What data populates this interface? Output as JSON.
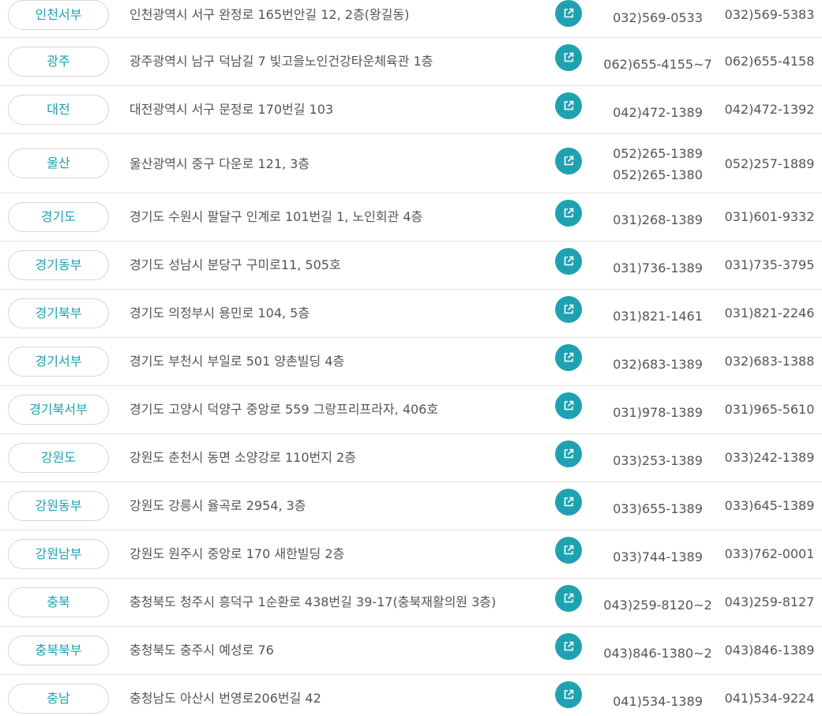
{
  "accent_color": "#1ea2b2",
  "link_icon": "external-link-icon",
  "rows": [
    {
      "region": "인천서부",
      "address": "인천광역시 서구 완정로 165번안길 12, 2층(왕길동)",
      "tel": [
        "032)569-0533"
      ],
      "fax": "032)569-5383"
    },
    {
      "region": "광주",
      "address": "광주광역시 남구 덕남길 7 빛고을노인건강타운체육관 1층",
      "tel": [
        "062)655-4155~7"
      ],
      "fax": "062)655-4158"
    },
    {
      "region": "대전",
      "address": "대전광역시 서구 문정로 170번길 103",
      "tel": [
        "042)472-1389"
      ],
      "fax": "042)472-1392"
    },
    {
      "region": "울산",
      "address": "울산광역시 중구 다운로 121, 3층",
      "tel": [
        "052)265-1389",
        "052)265-1380"
      ],
      "fax": "052)257-1889"
    },
    {
      "region": "경기도",
      "address": "경기도 수원시 팔달구 인계로 101번길 1, 노인회관 4층",
      "tel": [
        "031)268-1389"
      ],
      "fax": "031)601-9332"
    },
    {
      "region": "경기동부",
      "address": "경기도 성남시 분당구 구미로11, 505호",
      "tel": [
        "031)736-1389"
      ],
      "fax": "031)735-3795"
    },
    {
      "region": "경기북부",
      "address": "경기도 의정부시 용민로 104, 5층",
      "tel": [
        "031)821-1461"
      ],
      "fax": "031)821-2246"
    },
    {
      "region": "경기서부",
      "address": "경기도 부천시 부일로 501 양촌빌딩 4층",
      "tel": [
        "032)683-1389"
      ],
      "fax": "032)683-1388"
    },
    {
      "region": "경기북서부",
      "address": "경기도 고양시 덕양구 중앙로 559 그랑프리프라자, 406호",
      "tel": [
        "031)978-1389"
      ],
      "fax": "031)965-5610"
    },
    {
      "region": "강원도",
      "address": "강원도 춘천시 동면 소양강로 110번지 2층",
      "tel": [
        "033)253-1389"
      ],
      "fax": "033)242-1389"
    },
    {
      "region": "강원동부",
      "address": "강원도 강릉시 율곡로 2954, 3층",
      "tel": [
        "033)655-1389"
      ],
      "fax": "033)645-1389"
    },
    {
      "region": "강원남부",
      "address": "강원도 원주시 중앙로 170 새한빌딩 2층",
      "tel": [
        "033)744-1389"
      ],
      "fax": "033)762-0001"
    },
    {
      "region": "충북",
      "address": "충청북도 청주시 흥덕구 1순환로 438번길 39-17(충북재활의원 3층)",
      "tel": [
        "043)259-8120~2"
      ],
      "fax": "043)259-8127"
    },
    {
      "region": "충북북부",
      "address": "충청북도 충주시 예성로 76",
      "tel": [
        "043)846-1380~2"
      ],
      "fax": "043)846-1389"
    },
    {
      "region": "충남",
      "address": "충청남도 아산시 번영로206번길 42",
      "tel": [
        "041)534-1389"
      ],
      "fax": "041)534-9224"
    }
  ]
}
